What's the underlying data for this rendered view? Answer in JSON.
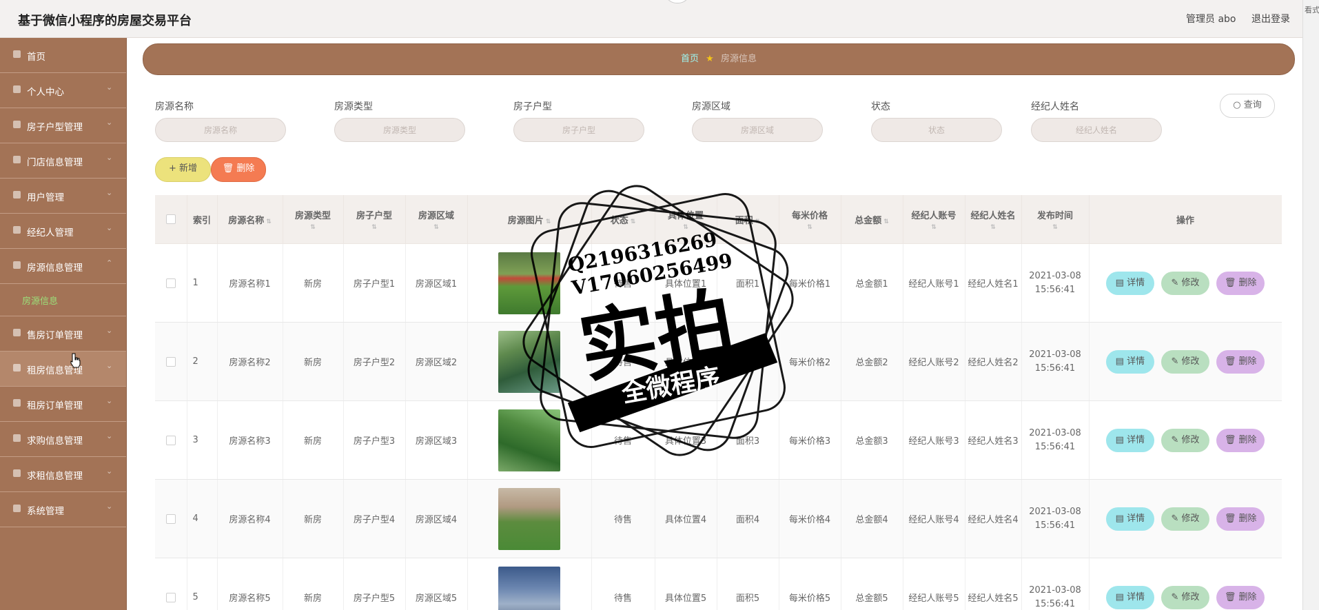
{
  "header": {
    "title": "基于微信小程序的房屋交易平台",
    "admin": "管理员 abo",
    "logout": "退出登录",
    "side_text": "看式"
  },
  "sidebar": {
    "items": [
      {
        "label": "首页",
        "icon": "home-icon",
        "arrow": false
      },
      {
        "label": "个人中心",
        "icon": "user-icon",
        "arrow": true
      },
      {
        "label": "房子户型管理",
        "icon": "layout-icon",
        "arrow": true
      },
      {
        "label": "门店信息管理",
        "icon": "store-icon",
        "arrow": true
      },
      {
        "label": "用户管理",
        "icon": "users-icon",
        "arrow": true
      },
      {
        "label": "经纪人管理",
        "icon": "agent-icon",
        "arrow": true
      },
      {
        "label": "房源信息管理",
        "icon": "building-icon",
        "arrow": true,
        "expanded": true
      },
      {
        "label": "售房订单管理",
        "icon": "order-icon",
        "arrow": true
      },
      {
        "label": "租房信息管理",
        "icon": "rent-icon",
        "arrow": true,
        "hover": true
      },
      {
        "label": "租房订单管理",
        "icon": "rent-order-icon",
        "arrow": true
      },
      {
        "label": "求购信息管理",
        "icon": "mail-icon",
        "arrow": true
      },
      {
        "label": "求租信息管理",
        "icon": "chat-icon",
        "arrow": true
      },
      {
        "label": "系统管理",
        "icon": "settings-icon",
        "arrow": true
      }
    ],
    "submenu": "房源信息"
  },
  "breadcrumb": {
    "home": "首页",
    "current": "房源信息"
  },
  "search": {
    "fields": [
      {
        "label": "房源名称",
        "placeholder": "房源名称"
      },
      {
        "label": "房源类型",
        "placeholder": "房源类型"
      },
      {
        "label": "房子户型",
        "placeholder": "房子户型"
      },
      {
        "label": "房源区域",
        "placeholder": "房源区域"
      },
      {
        "label": "状态",
        "placeholder": "状态"
      },
      {
        "label": "经纪人姓名",
        "placeholder": "经纪人姓名"
      }
    ],
    "query": "查询"
  },
  "actions": {
    "add": "新增",
    "delete": "删除"
  },
  "table": {
    "headers": [
      "索引",
      "房源名称",
      "房源类型",
      "房子户型",
      "房源区域",
      "房源图片",
      "状态",
      "具体位置",
      "面积",
      "每米价格",
      "总金额",
      "经纪人账号",
      "经纪人姓名",
      "发布时间",
      "操作"
    ],
    "rows": [
      {
        "idx": "1",
        "name": "房源名称1",
        "type": "新房",
        "layout": "房子户型1",
        "area": "房源区域1",
        "status": "待售",
        "location": "具体位置1",
        "size": "面积1",
        "price": "每米价格1",
        "total": "总金额1",
        "agent_account": "经纪人账号1",
        "agent_name": "经纪人姓名1",
        "date": "2021-03-08",
        "time": "15:56:41"
      },
      {
        "idx": "2",
        "name": "房源名称2",
        "type": "新房",
        "layout": "房子户型2",
        "area": "房源区域2",
        "status": "待售",
        "location": "具体位置2",
        "size": "面积2",
        "price": "每米价格2",
        "total": "总金额2",
        "agent_account": "经纪人账号2",
        "agent_name": "经纪人姓名2",
        "date": "2021-03-08",
        "time": "15:56:41"
      },
      {
        "idx": "3",
        "name": "房源名称3",
        "type": "新房",
        "layout": "房子户型3",
        "area": "房源区域3",
        "status": "待售",
        "location": "具体位置3",
        "size": "面积3",
        "price": "每米价格3",
        "total": "总金额3",
        "agent_account": "经纪人账号3",
        "agent_name": "经纪人姓名3",
        "date": "2021-03-08",
        "time": "15:56:41"
      },
      {
        "idx": "4",
        "name": "房源名称4",
        "type": "新房",
        "layout": "房子户型4",
        "area": "房源区域4",
        "status": "待售",
        "location": "具体位置4",
        "size": "面积4",
        "price": "每米价格4",
        "total": "总金额4",
        "agent_account": "经纪人账号4",
        "agent_name": "经纪人姓名4",
        "date": "2021-03-08",
        "time": "15:56:41"
      },
      {
        "idx": "5",
        "name": "房源名称5",
        "type": "新房",
        "layout": "房子户型5",
        "area": "房源区域5",
        "status": "待售",
        "location": "具体位置5",
        "size": "面积5",
        "price": "每米价格5",
        "total": "总金额5",
        "agent_account": "经纪人账号5",
        "agent_name": "经纪人姓名5",
        "date": "2021-03-08",
        "time": "15:56:41"
      }
    ],
    "ops": {
      "detail": "详情",
      "edit": "修改",
      "delete": "删除"
    }
  },
  "watermark": {
    "line1": "Q2196316269",
    "line2": "V17060256499",
    "big": "实拍",
    "ribbon": "全微程序"
  },
  "colors": {
    "sidebar": "#a37356",
    "accent_link": "#9ef7f2",
    "submenu_active": "#9be07a",
    "add_button": "#ece27c",
    "delete_button": "#f47b52"
  }
}
